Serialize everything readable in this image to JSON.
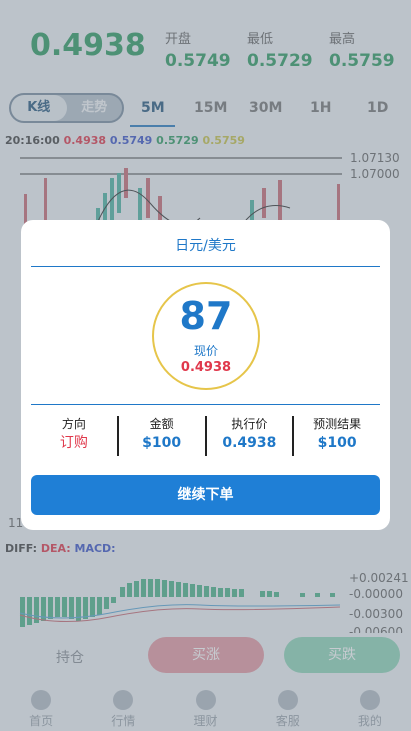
{
  "header": {
    "price": "0.4938",
    "open_label": "开盘",
    "open_value": "0.5749",
    "low_label": "最低",
    "low_value": "0.5729",
    "high_label": "最高",
    "high_value": "0.5759"
  },
  "chart_switch": {
    "kline": "K线",
    "trend": "走势"
  },
  "timeframes": [
    "5M",
    "15M",
    "30M",
    "1H",
    "1D"
  ],
  "ohlc": {
    "time": "20:16:00",
    "v1": "0.4938",
    "v2": "0.5749",
    "v3": "0.5729",
    "v4": "0.5759"
  },
  "price_axis": [
    "1.07130",
    "1.07000"
  ],
  "side_labels": [
    "11"
  ],
  "macd": {
    "diff": "DIFF:",
    "dea": "DEA:",
    "macd": "MACD:",
    "axis": [
      "+0.00241",
      "-0.00000",
      "-0.00300",
      "-0.00600"
    ]
  },
  "actions": {
    "hold": "持仓",
    "buy_up": "买涨",
    "buy_down": "买跌"
  },
  "tabs": [
    "首页",
    "行情",
    "理财",
    "客服",
    "我的"
  ],
  "modal": {
    "title": "日元/美元",
    "countdown": "87",
    "now_label": "现价",
    "now_price": "0.4938",
    "cols": [
      {
        "h": "方向",
        "v": "订购"
      },
      {
        "h": "金额",
        "v": "$100"
      },
      {
        "h": "执行价",
        "v": "0.4938"
      },
      {
        "h": "预测结果",
        "v": "$100"
      }
    ],
    "submit": "继续下单"
  },
  "colors": {
    "up": "#2f9c63",
    "down": "#e0384b",
    "accent": "#1f78c8"
  }
}
